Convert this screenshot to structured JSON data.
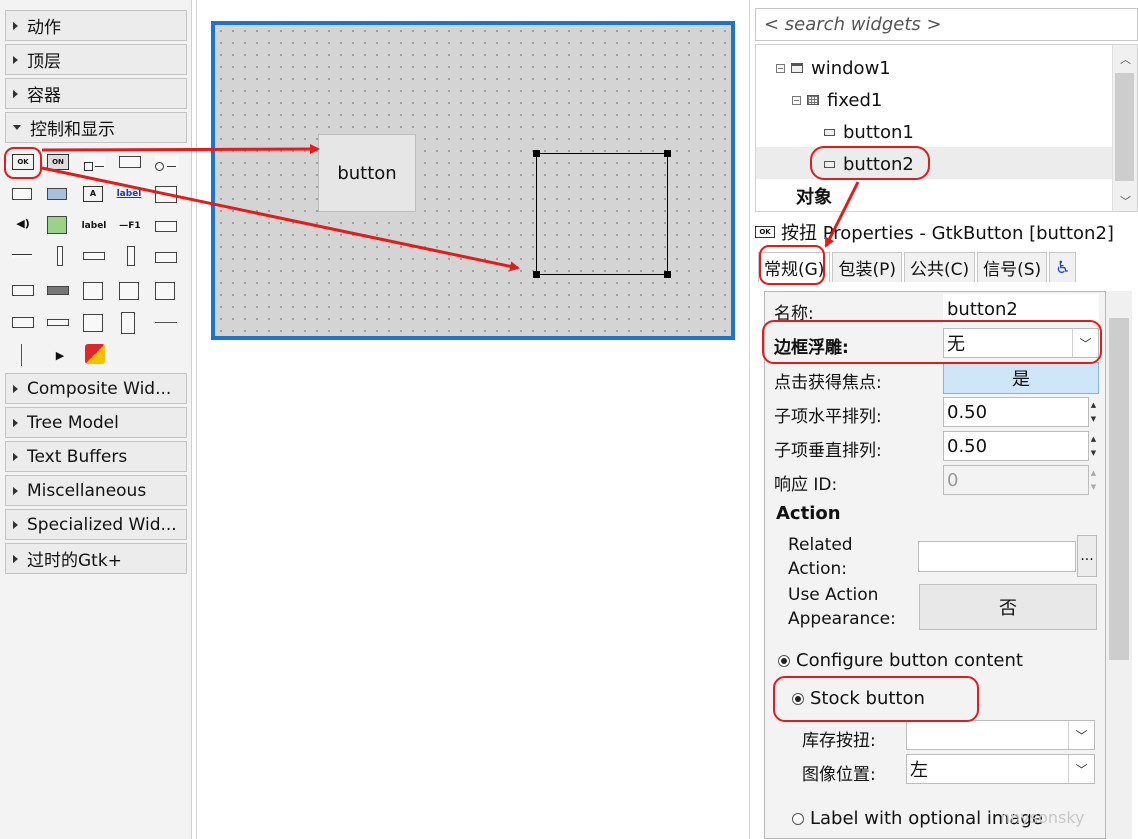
{
  "palette": {
    "categories_top": [
      "动作",
      "顶层",
      "容器",
      "控制和显示"
    ],
    "categories_bottom": [
      "Composite Wid...",
      "Tree Model",
      "Text Buffers",
      "Miscellaneous",
      "Specialized Wid...",
      "过时的Gtk+"
    ],
    "widget_icons": {
      "ok": "OK",
      "on": "ON",
      "label": "label",
      "label_blue": "label",
      "f1": "—F1"
    }
  },
  "canvas": {
    "button_label": "button"
  },
  "inspector": {
    "search_placeholder": "< search widgets >",
    "tree": {
      "window1": "window1",
      "fixed1": "fixed1",
      "button1": "button1",
      "button2": "button2",
      "objects_header": "对象"
    },
    "header": {
      "icon": "OK",
      "text": "按扭 Properties - GtkButton [button2]"
    },
    "tabs": [
      {
        "label": "常规(G)"
      },
      {
        "label": "包装(P)"
      },
      {
        "label": "公共(C)"
      },
      {
        "label": "信号(S)"
      }
    ],
    "accessibility_icon": "♿",
    "props": {
      "name_label": "名称:",
      "name_value": "button2",
      "relief_label": "边框浮雕:",
      "relief_value": "无",
      "focus_label": "点击获得焦点:",
      "focus_value": "是",
      "xalign_label": "子项水平排列:",
      "xalign_value": "0.50",
      "yalign_label": "子项垂直排列:",
      "yalign_value": "0.50",
      "response_label": "响应 ID:",
      "response_value": "0",
      "action_header": "Action",
      "related_action_label_1": "Related",
      "related_action_label_2": "Action:",
      "related_action_btn": "...",
      "use_appearance_label_1": "Use Action",
      "use_appearance_label_2": "Appearance:",
      "use_appearance_value": "否",
      "configure_content": "Configure button content",
      "stock_button": "Stock button",
      "stock_label": "库存按扭:",
      "image_pos_label": "图像位置:",
      "image_pos_value": "左",
      "label_with_image": "Label with optional image"
    }
  },
  "watermark": "nnysonsky"
}
